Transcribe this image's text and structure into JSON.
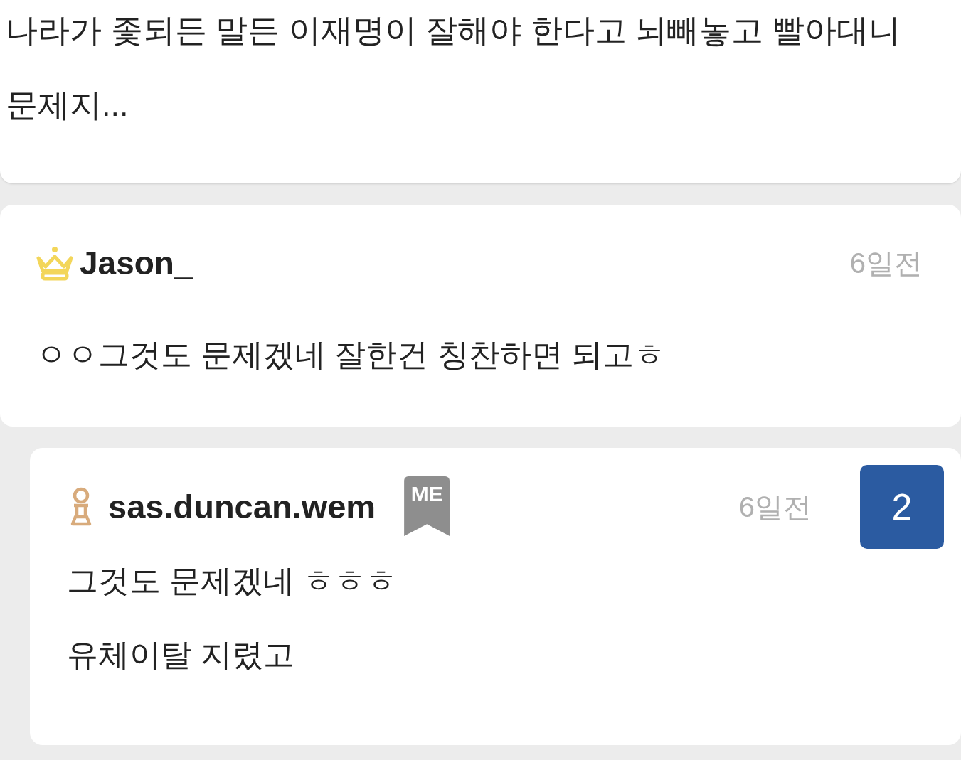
{
  "post": {
    "body": "나라가 좇되든 말든 이재명이 잘해야 한다고 뇌빼놓고 빨아대니 문제지..."
  },
  "comments": [
    {
      "kind": "comment",
      "rank_icon": {
        "kind": "crown"
      },
      "author": "Jason_",
      "is_me": false,
      "time": "6일전",
      "lines": [
        "ㅇㅇ그것도 문제겠네 잘한건 칭찬하면 되고ㅎ"
      ]
    },
    {
      "kind": "reply",
      "rank_icon": {
        "kind": "pawn"
      },
      "author": "sas.duncan.wem",
      "is_me": true,
      "me_label": "ME",
      "time": "6일전",
      "count": "2",
      "lines": [
        "그것도 문제겠네 ㅎㅎㅎ",
        "유체이탈 지렸고"
      ]
    }
  ]
}
